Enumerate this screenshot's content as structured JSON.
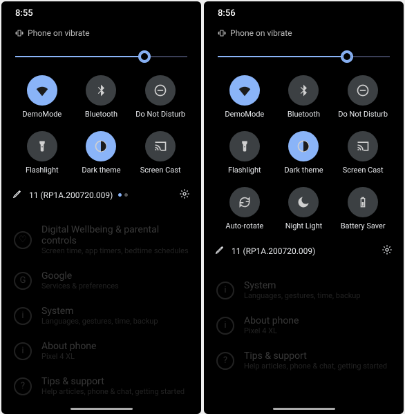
{
  "accent": "#8ab4f8",
  "phones": [
    {
      "time": "8:55",
      "vibrate_label": "Phone on vibrate",
      "brightness_pct": 75,
      "tiles": [
        {
          "icon": "wifi",
          "label": "DemoMode",
          "active": true
        },
        {
          "icon": "bluetooth",
          "label": "Bluetooth",
          "active": false
        },
        {
          "icon": "dnd",
          "label": "Do Not Disturb",
          "active": false
        },
        {
          "icon": "flashlight",
          "label": "Flashlight",
          "active": false
        },
        {
          "icon": "darktheme",
          "label": "Dark theme",
          "active": true
        },
        {
          "icon": "cast",
          "label": "Screen Cast",
          "active": false
        }
      ],
      "build_label": "11 (RP1A.200720.009)",
      "show_dots": true,
      "settings_under": [
        {
          "icon": "wellbeing",
          "title": "Digital Wellbeing & parental controls",
          "sub": "Screen time, app timers, bedtime schedules"
        },
        {
          "icon": "G",
          "title": "Google",
          "sub": "Services & preferences"
        },
        {
          "icon": "info",
          "title": "System",
          "sub": "Languages, gestures, time, backup"
        },
        {
          "icon": "info",
          "title": "About phone",
          "sub": "Pixel 4 XL"
        },
        {
          "icon": "?",
          "title": "Tips & support",
          "sub": "Help articles, phone & chat, getting started"
        }
      ]
    },
    {
      "time": "8:56",
      "vibrate_label": "Phone on vibrate",
      "brightness_pct": 75,
      "tiles": [
        {
          "icon": "wifi",
          "label": "DemoMode",
          "active": true
        },
        {
          "icon": "bluetooth",
          "label": "Bluetooth",
          "active": false
        },
        {
          "icon": "dnd",
          "label": "Do Not Disturb",
          "active": false
        },
        {
          "icon": "flashlight",
          "label": "Flashlight",
          "active": false
        },
        {
          "icon": "darktheme",
          "label": "Dark theme",
          "active": true
        },
        {
          "icon": "cast",
          "label": "Screen Cast",
          "active": false
        },
        {
          "icon": "rotate",
          "label": "Auto-rotate",
          "active": false
        },
        {
          "icon": "moon",
          "label": "Night Light",
          "active": false
        },
        {
          "icon": "battery",
          "label": "Battery Saver",
          "active": false
        }
      ],
      "build_label": "11 (RP1A.200720.009)",
      "show_dots": false,
      "settings_under": [
        {
          "icon": "info",
          "title": "System",
          "sub": "Languages, gestures, time, backup"
        },
        {
          "icon": "info",
          "title": "About phone",
          "sub": "Pixel 4 XL"
        },
        {
          "icon": "?",
          "title": "Tips & support",
          "sub": "Help articles, phone & chat, getting started"
        }
      ]
    }
  ]
}
